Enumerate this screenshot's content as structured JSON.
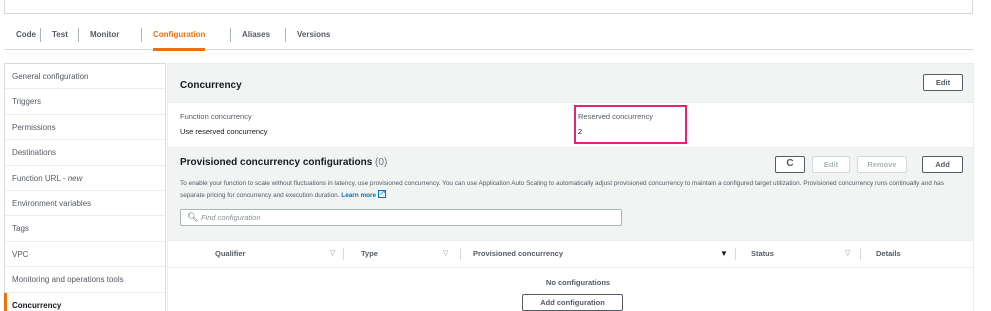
{
  "tabs": [
    {
      "label": "Code"
    },
    {
      "label": "Test"
    },
    {
      "label": "Monitor"
    },
    {
      "label": "Configuration",
      "active": true
    },
    {
      "label": "Aliases"
    },
    {
      "label": "Versions"
    }
  ],
  "sidebar": {
    "items": [
      {
        "label": "General configuration"
      },
      {
        "label": "Triggers"
      },
      {
        "label": "Permissions"
      },
      {
        "label": "Destinations"
      },
      {
        "label": "Function URL - ",
        "suffix": "new"
      },
      {
        "label": "Environment variables"
      },
      {
        "label": "Tags"
      },
      {
        "label": "VPC"
      },
      {
        "label": "Monitoring and operations tools"
      },
      {
        "label": "Concurrency",
        "active": true
      }
    ]
  },
  "concurrency": {
    "title": "Concurrency",
    "edit_label": "Edit",
    "function_concurrency_label": "Function concurrency",
    "function_concurrency_value": "Use reserved concurrency",
    "reserved_label": "Reserved concurrency",
    "reserved_value": "2"
  },
  "provisioned": {
    "title": "Provisioned concurrency configurations",
    "count": "(0)",
    "refresh_label": "C",
    "edit_label": "Edit",
    "remove_label": "Remove",
    "add_label": "Add",
    "description": "To enable your function to scale without fluctuations in latency, use provisioned concurrency. You can use Application Auto Scaling to automatically adjust provisioned concurrency to maintain a configured target utilization. Provisioned concurrency runs continually and has separate pricing for concurrency and execution duration.",
    "learn_more": "Learn more",
    "search_placeholder": "Find configuration",
    "columns": [
      "Qualifier",
      "Type",
      "Provisioned concurrency",
      "Status",
      "Details"
    ],
    "empty_text": "No configurations",
    "add_config_label": "Add configuration"
  },
  "colors": {
    "accent": "#ec7211",
    "highlight": "#e0247a",
    "link": "#0073bb"
  }
}
